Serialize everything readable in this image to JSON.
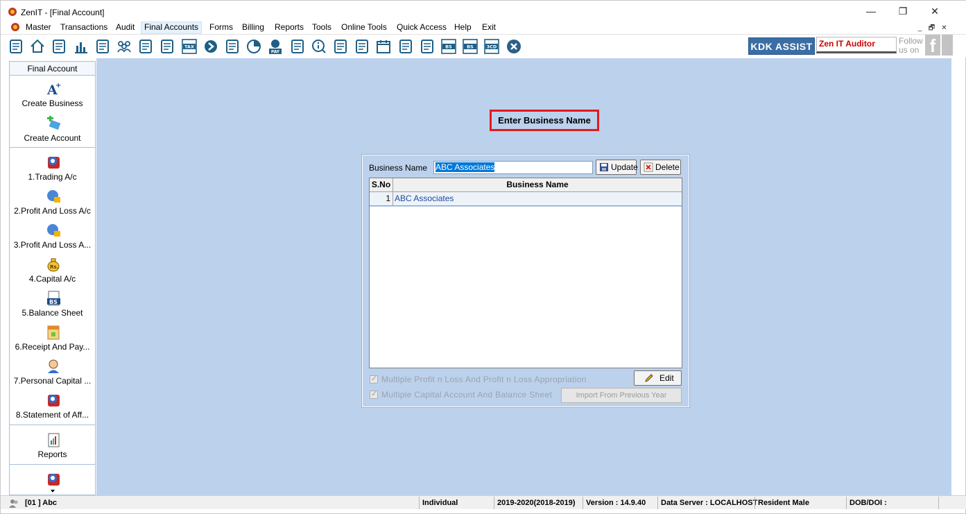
{
  "window": {
    "title": "ZenIT - [Final Account]",
    "controls": [
      "—",
      "❐",
      "✕"
    ],
    "mdi_controls": [
      "_",
      "🗗",
      "✕"
    ]
  },
  "menu": [
    "Master",
    "Transactions",
    "Audit",
    "Final Accounts",
    "Forms",
    "Billing",
    "Reports",
    "Tools",
    "Online Tools",
    "Quick Access",
    "Help",
    "Exit"
  ],
  "menu_active": "Final Accounts",
  "toolbar": {
    "icons": [
      "calculator-icon",
      "home-icon",
      "building-icon",
      "bar-chart-icon",
      "gift-icon",
      "users-icon",
      "hammer-icon",
      "filter-icon",
      "tax-icon",
      "arrow-circle-icon",
      "grid-calc-icon",
      "pie-icon",
      "pay-icon",
      "book-icon",
      "info-icon",
      "report-icon",
      "doc-user-icon",
      "calendar-icon",
      "folder-add-icon",
      "refresh-doc-icon",
      "bs-icon",
      "bs-sign-icon",
      "3cd-icon",
      "close-circle-icon"
    ],
    "kdk_label": "KDK ASSIST",
    "zen_label": "Zen IT Auditor",
    "follow_line1": "Follow",
    "follow_line2": "us on",
    "fb_glyph": "f"
  },
  "sidebar": {
    "header": "Final Account",
    "items": [
      {
        "label": "Create Business",
        "icon": "create-business-icon"
      },
      {
        "label": "Create Account",
        "icon": "create-account-icon"
      },
      {
        "label": "1.Trading A/c",
        "icon": "trading-icon"
      },
      {
        "label": "2.Profit And Loss A/c",
        "icon": "profit-loss-icon"
      },
      {
        "label": "3.Profit And Loss A...",
        "icon": "profit-loss-appropriation-icon"
      },
      {
        "label": "4.Capital A/c",
        "icon": "capital-bag-icon"
      },
      {
        "label": "5.Balance Sheet",
        "icon": "balance-sheet-icon"
      },
      {
        "label": "6.Receipt And Pay...",
        "icon": "receipt-payment-icon"
      },
      {
        "label": "7.Personal Capital ...",
        "icon": "personal-capital-icon"
      },
      {
        "label": "8.Statement of Aff...",
        "icon": "statement-affairs-icon"
      },
      {
        "label": "Reports",
        "icon": "reports-icon"
      }
    ],
    "more_icon": "scroll-down-icon"
  },
  "main": {
    "heading": "Enter Business Name",
    "business_label": "Business Name",
    "business_value": "ABC Associates",
    "update_label": "Update",
    "delete_label": "Delete",
    "grid": {
      "columns": [
        "S.No",
        "Business Name"
      ],
      "rows": [
        {
          "sno": "1",
          "name": "ABC Associates"
        }
      ]
    },
    "check1": "Multiple Profit n Loss And Profit n Loss Appropriation",
    "check2": "Multiple Capital Account And Balance Sheet",
    "edit_label": "Edit",
    "import_label": "Import From Previous Year"
  },
  "status": {
    "company": "[01 ] Abc",
    "type": "Individual",
    "year": "2019-2020(2018-2019)",
    "version": "Version : 14.9.40",
    "server": "Data Server : LOCALHOST",
    "resident": "Resident Male",
    "dob": "DOB/DOI :"
  },
  "colors": {
    "main_bg": "#bcd1ec",
    "heading_border": "#e21a1a",
    "kdk_bg": "#3a6ea5",
    "zen_text": "#cc0000",
    "selection": "#0078d7"
  }
}
